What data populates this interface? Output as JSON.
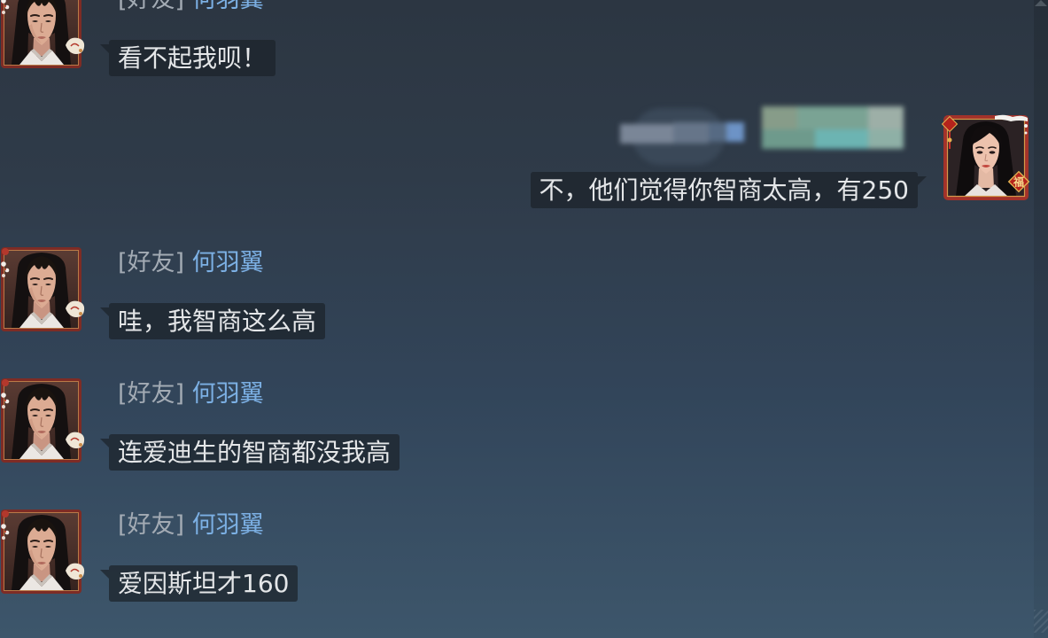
{
  "chat": {
    "messages": [
      {
        "tag": "[好友]",
        "sender": "何羽翼",
        "text": "看不起我呗！"
      },
      {
        "text": "不，他们觉得你智商太高，有250"
      },
      {
        "tag": "[好友]",
        "sender": "何羽翼",
        "text": "哇，我智商这么高"
      },
      {
        "tag": "[好友]",
        "sender": "何羽翼",
        "text": "连爱迪生的智商都没我高"
      },
      {
        "tag": "[好友]",
        "sender": "何羽翼",
        "text": "爱因斯坦才160"
      }
    ]
  },
  "friend_avatar": {
    "icon": "male-character-portrait-icon"
  },
  "self_avatar": {
    "icon": "female-character-portrait-icon",
    "frame_ornament": "福"
  },
  "colors": {
    "background_top": "#2c3642",
    "background_mid": "#32455a",
    "background_bottom": "#3d566b",
    "bubble": "#1c2229b8",
    "bubble_text": "#e4e6e8",
    "friend_tag": "#a3abb4",
    "sender_name": "#7cb0e4",
    "avatar_frame": "#7e2c25"
  }
}
